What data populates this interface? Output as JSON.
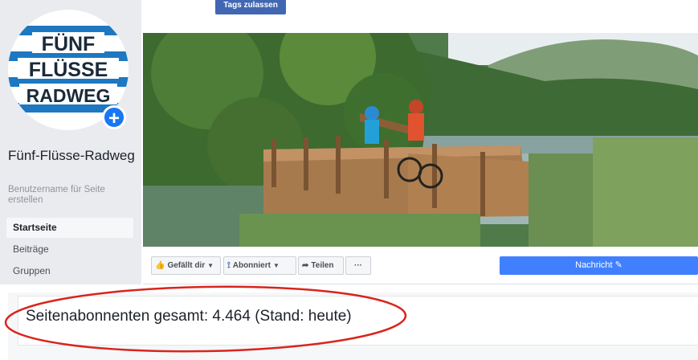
{
  "top_button": {
    "label": "Tags zulassen"
  },
  "logo": {
    "line1": "FÜNF",
    "line2": "FLÜSSE",
    "line3": "RADWEG"
  },
  "sidebar": {
    "page_name": "Fünf-Flüsse-Radweg",
    "username_link": "Benutzername für Seite erstellen",
    "items": [
      {
        "label": "Startseite",
        "active": true
      },
      {
        "label": "Beiträge",
        "active": false
      },
      {
        "label": "Gruppen",
        "active": false
      }
    ]
  },
  "actions": {
    "like": "Gefällt dir",
    "follow": "Abonniert",
    "share": "Teilen",
    "more": "···",
    "message": "Nachricht"
  },
  "stats": {
    "text": "Seitenabonnenten gesamt: 4.464 (Stand: heute)"
  },
  "colors": {
    "brand_blue": "#4267b2",
    "message_blue": "#4080ff",
    "annotation_red": "#d9241c",
    "logo_blue": "#1d78c1"
  }
}
